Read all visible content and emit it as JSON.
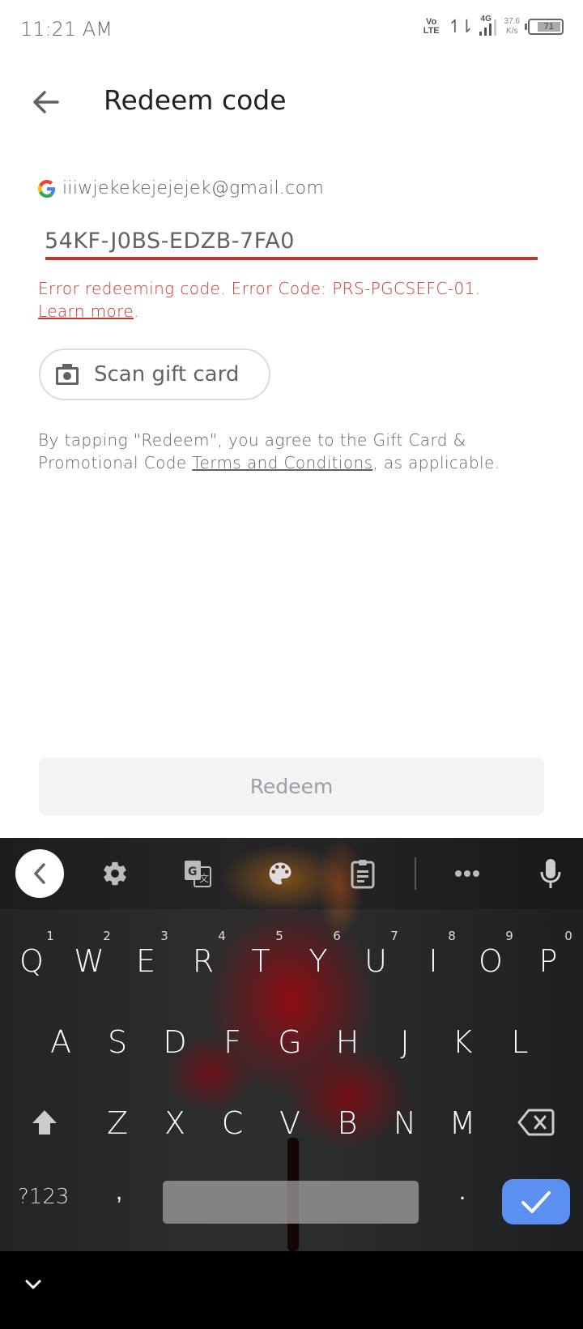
{
  "status_bar": {
    "time": "11:21 AM",
    "volte_top": "Vo",
    "volte_bottom": "LTE",
    "network_type": "4G",
    "speed_value": "37.6",
    "speed_unit": "K/s",
    "battery_level": "71"
  },
  "header": {
    "back_icon": "arrow-back-icon",
    "title": "Redeem code"
  },
  "account": {
    "icon": "google-logo-icon",
    "email": "iiiwjekekejejejek@gmail.com"
  },
  "code_field": {
    "value": "54KF-J0BS-EDZB-7FA0",
    "state": "error",
    "underline_color": "#c5372c"
  },
  "error": {
    "message": "Error redeeming code. Error Code: PRS-PGCSEFC-01.",
    "link_label": "Learn more",
    "link_suffix": ".",
    "color": "#c5372c"
  },
  "scan_button": {
    "icon": "camera-icon",
    "label": "Scan gift card"
  },
  "terms": {
    "prefix": "By tapping \"Redeem\", you agree to the Gift Card & Promotional Code ",
    "link_label": "Terms and Conditions",
    "suffix": ", as applicable."
  },
  "redeem_button": {
    "label": "Redeem",
    "enabled": false
  },
  "keyboard": {
    "toolbar": [
      {
        "name": "collapse-toolbar",
        "icon": "chevron-left-icon"
      },
      {
        "name": "settings",
        "icon": "gear-icon"
      },
      {
        "name": "translate",
        "icon": "translate-icon"
      },
      {
        "name": "theme",
        "icon": "palette-icon"
      },
      {
        "name": "clipboard",
        "icon": "clipboard-icon"
      },
      {
        "name": "more",
        "icon": "more-horiz-icon"
      },
      {
        "name": "voice",
        "icon": "microphone-icon"
      }
    ],
    "row1": [
      {
        "key": "Q",
        "hint": "1"
      },
      {
        "key": "W",
        "hint": "2"
      },
      {
        "key": "E",
        "hint": "3"
      },
      {
        "key": "R",
        "hint": "4"
      },
      {
        "key": "T",
        "hint": "5"
      },
      {
        "key": "Y",
        "hint": "6"
      },
      {
        "key": "U",
        "hint": "7"
      },
      {
        "key": "I",
        "hint": "8"
      },
      {
        "key": "O",
        "hint": "9"
      },
      {
        "key": "P",
        "hint": "0"
      }
    ],
    "row2": [
      "A",
      "S",
      "D",
      "F",
      "G",
      "H",
      "J",
      "K",
      "L"
    ],
    "row3": [
      "Z",
      "X",
      "C",
      "V",
      "B",
      "N",
      "M"
    ],
    "symbols_label": "?123",
    "comma": ",",
    "period": ".",
    "enter_color": "#5b8ff0"
  },
  "nav_bar": {
    "hide_keyboard_icon": "chevron-down-icon"
  }
}
